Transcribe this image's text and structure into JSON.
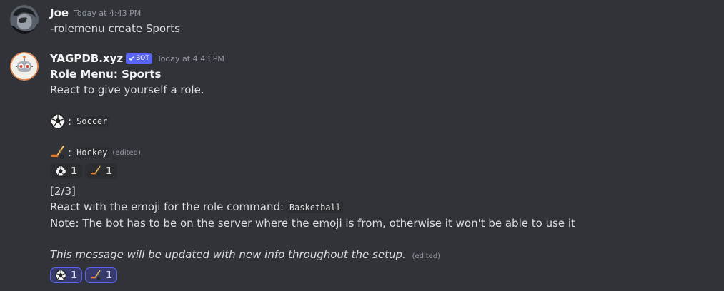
{
  "messages": [
    {
      "username": "Joe",
      "timestamp": "Today at 4:43 PM",
      "avatar_icon": "dark-anime-avatar",
      "text": "-rolemenu create Sports"
    },
    {
      "username": "YAGPDB.xyz",
      "bot_tag": "BOT",
      "timestamp": "Today at 4:43 PM",
      "avatar_icon": "robot-avatar",
      "title": "Role Menu: Sports",
      "intro": "React to give yourself a role.",
      "options": [
        {
          "emoji": "soccer-ball-icon",
          "name": "Soccer",
          "edited": ""
        },
        {
          "emoji": "hockey-stick-icon",
          "name": "Hockey",
          "edited": "(edited)"
        }
      ],
      "reactions_first": [
        {
          "emoji": "soccer-ball-icon",
          "count": "1"
        },
        {
          "emoji": "hockey-stick-icon",
          "count": "1"
        }
      ],
      "step": "[2/3]",
      "prompt": "React with the emoji for the role command:",
      "prompt_code": "Basketball",
      "note": "Note: The bot has to be on the server where the emoji is from, otherwise it won't be able to use it",
      "footer": "This message will be updated with new info throughout the setup.",
      "footer_edited": "(edited)",
      "reactions_second": [
        {
          "emoji": "soccer-ball-icon",
          "count": "1",
          "active": true
        },
        {
          "emoji": "hockey-stick-icon",
          "count": "1",
          "active": true
        }
      ]
    }
  ],
  "colors": {
    "background": "#313338",
    "accent": "#5865f2",
    "text": "#dbdee1",
    "muted": "#949ba4"
  }
}
